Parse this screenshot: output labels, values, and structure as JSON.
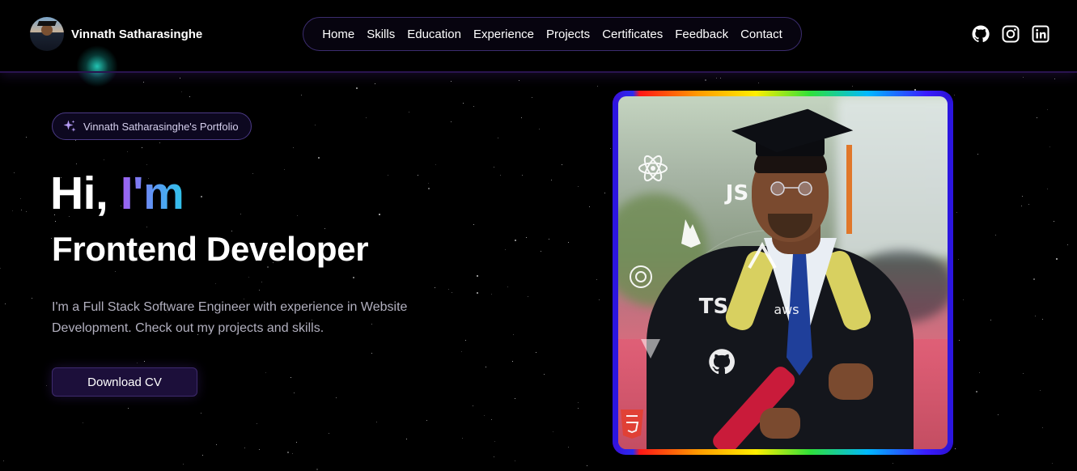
{
  "header": {
    "brand_name": "Vinnath Satharasinghe",
    "nav": [
      "Home",
      "Skills",
      "Education",
      "Experience",
      "Projects",
      "Certificates",
      "Feedback",
      "Contact"
    ],
    "socials": [
      "github-icon",
      "instagram-icon",
      "linkedin-icon"
    ]
  },
  "hero": {
    "badge": "Vinnath Satharasinghe's Portfolio",
    "greeting_prefix": "Hi, ",
    "greeting_highlight": "I'm",
    "role": "Frontend Developer",
    "description": "I'm a Full Stack Software Engineer with experience in Website Development. Check out my projects and skills.",
    "cta": "Download CV"
  },
  "photo": {
    "tech_icons": {
      "js": "JS",
      "ts": "TS",
      "aws": "aws"
    }
  },
  "colors": {
    "background": "#000000",
    "accent_purple": "#a25cf0",
    "accent_cyan": "#2ec3e8",
    "button_bg": "#1c0f3a"
  }
}
